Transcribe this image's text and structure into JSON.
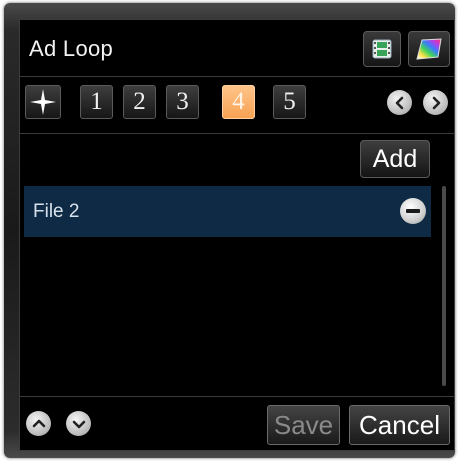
{
  "window": {
    "title": "Ad Loop"
  },
  "toolbar": {
    "media_icon": "film-icon",
    "color_icon": "color-palette-icon"
  },
  "tabs": {
    "special_icon": "sparkle-icon",
    "items": [
      {
        "label": "1",
        "active": false
      },
      {
        "label": "2",
        "active": false
      },
      {
        "label": "3",
        "active": false
      },
      {
        "label": "4",
        "active": true
      },
      {
        "label": "5",
        "active": false
      }
    ],
    "prev_icon": "chevron-left-icon",
    "next_icon": "chevron-right-icon",
    "active_color": "#f9a85c"
  },
  "list": {
    "add_label": "Add",
    "items": [
      {
        "label": "File 2",
        "selected": true
      }
    ],
    "selected_color": "#0f2a44",
    "remove_icon": "minus-circle-icon"
  },
  "footer": {
    "up_icon": "chevron-up-icon",
    "down_icon": "chevron-down-icon",
    "save_label": "Save",
    "save_enabled": false,
    "cancel_label": "Cancel"
  }
}
